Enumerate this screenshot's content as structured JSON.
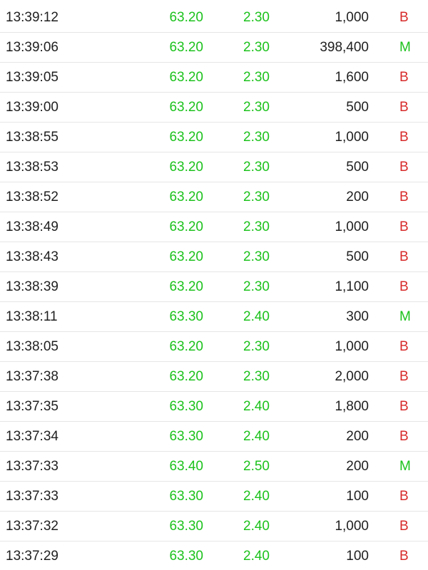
{
  "colors": {
    "up": "#1cc21c",
    "buy": "#d72a2a",
    "text": "#1f1f1f",
    "divider": "#e6e6e6"
  },
  "trades": [
    {
      "time": "13:39:12",
      "price": "63.20",
      "change": "2.30",
      "volume": "1,000",
      "side": "B"
    },
    {
      "time": "13:39:06",
      "price": "63.20",
      "change": "2.30",
      "volume": "398,400",
      "side": "M"
    },
    {
      "time": "13:39:05",
      "price": "63.20",
      "change": "2.30",
      "volume": "1,600",
      "side": "B"
    },
    {
      "time": "13:39:00",
      "price": "63.20",
      "change": "2.30",
      "volume": "500",
      "side": "B"
    },
    {
      "time": "13:38:55",
      "price": "63.20",
      "change": "2.30",
      "volume": "1,000",
      "side": "B"
    },
    {
      "time": "13:38:53",
      "price": "63.20",
      "change": "2.30",
      "volume": "500",
      "side": "B"
    },
    {
      "time": "13:38:52",
      "price": "63.20",
      "change": "2.30",
      "volume": "200",
      "side": "B"
    },
    {
      "time": "13:38:49",
      "price": "63.20",
      "change": "2.30",
      "volume": "1,000",
      "side": "B"
    },
    {
      "time": "13:38:43",
      "price": "63.20",
      "change": "2.30",
      "volume": "500",
      "side": "B"
    },
    {
      "time": "13:38:39",
      "price": "63.20",
      "change": "2.30",
      "volume": "1,100",
      "side": "B"
    },
    {
      "time": "13:38:11",
      "price": "63.30",
      "change": "2.40",
      "volume": "300",
      "side": "M"
    },
    {
      "time": "13:38:05",
      "price": "63.20",
      "change": "2.30",
      "volume": "1,000",
      "side": "B"
    },
    {
      "time": "13:37:38",
      "price": "63.20",
      "change": "2.30",
      "volume": "2,000",
      "side": "B"
    },
    {
      "time": "13:37:35",
      "price": "63.30",
      "change": "2.40",
      "volume": "1,800",
      "side": "B"
    },
    {
      "time": "13:37:34",
      "price": "63.30",
      "change": "2.40",
      "volume": "200",
      "side": "B"
    },
    {
      "time": "13:37:33",
      "price": "63.40",
      "change": "2.50",
      "volume": "200",
      "side": "M"
    },
    {
      "time": "13:37:33",
      "price": "63.30",
      "change": "2.40",
      "volume": "100",
      "side": "B"
    },
    {
      "time": "13:37:32",
      "price": "63.30",
      "change": "2.40",
      "volume": "1,000",
      "side": "B"
    },
    {
      "time": "13:37:29",
      "price": "63.30",
      "change": "2.40",
      "volume": "100",
      "side": "B"
    }
  ]
}
